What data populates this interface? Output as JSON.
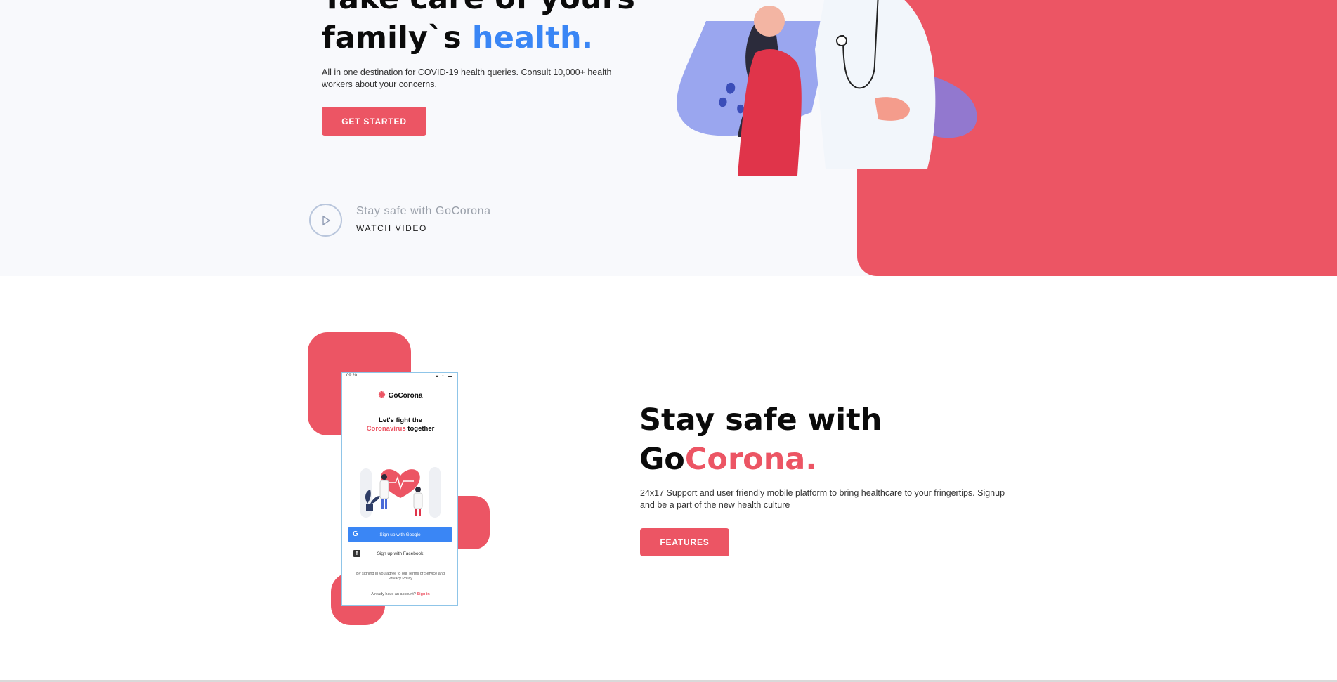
{
  "hero": {
    "title_line1": "Take care of yours",
    "title_line2_prefix": "family`s ",
    "title_line2_accent": "health.",
    "description": "All in one destination for COVID-19 health queries. Consult 10,000+ health workers about your concerns.",
    "cta_label": "GET STARTED",
    "video_caption": "Stay safe with GoCorona",
    "video_cta": "WATCH VIDEO"
  },
  "app_section": {
    "phone": {
      "status_time": "09:20",
      "logo_text": "GoCorona",
      "headline_line1": "Let's fight the",
      "headline_accent": "Coronavirus",
      "headline_suffix": " together",
      "google_button": "Sign up with Google",
      "facebook_button": "Sign up with Facebook",
      "terms_text": "By signing in you agree to our Terms of Service and Privacy Policy",
      "signin_prefix": "Already have an account? ",
      "signin_link": "Sign in"
    },
    "title_line1": "Stay safe with",
    "title_line2_prefix": "Go",
    "title_line2_accent": "Corona.",
    "description": "24x17 Support and user friendly mobile platform to bring healthcare to your fringertips. Signup and be a part of the new health culture",
    "cta_label": "FEATURES"
  },
  "colors": {
    "brand_red": "#ec5564",
    "accent_blue": "#3a86f5",
    "hero_background": "#f8f9fc"
  }
}
